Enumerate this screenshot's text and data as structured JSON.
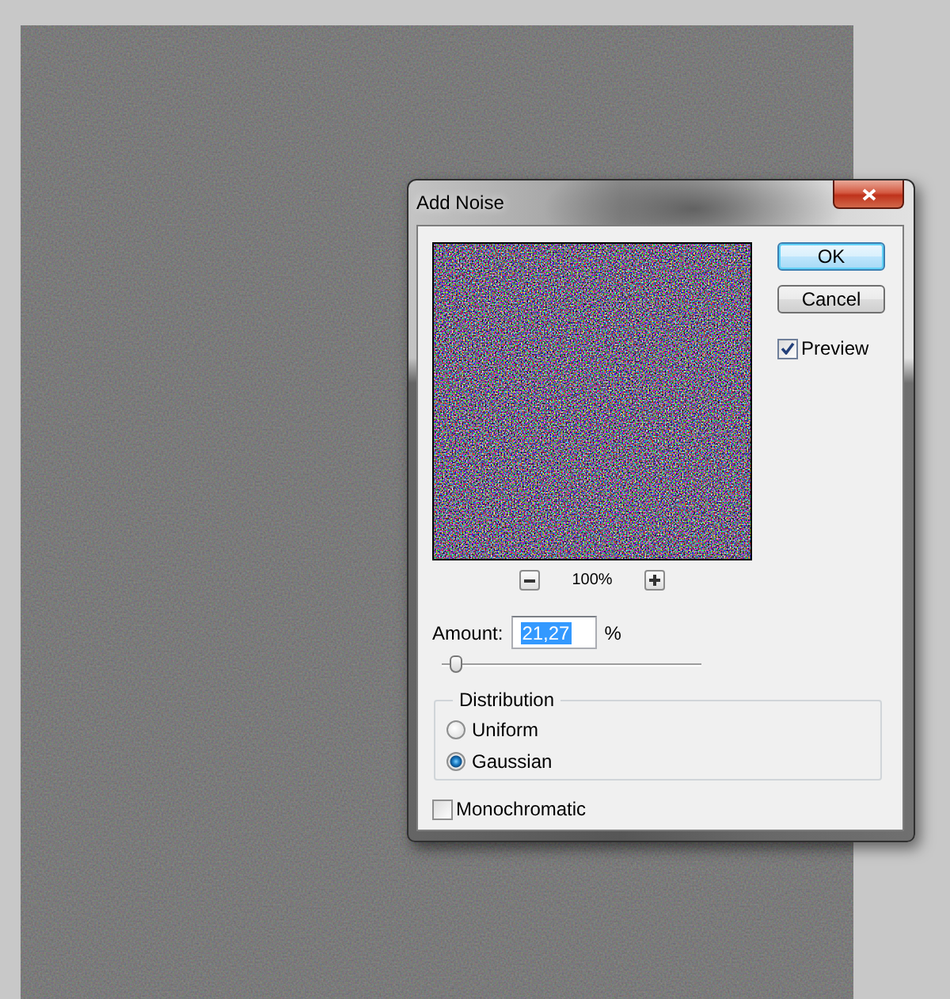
{
  "dialog": {
    "title": "Add Noise",
    "preview": {
      "zoom_level": "100%"
    },
    "buttons": [
      {
        "label": "OK",
        "default": true
      },
      {
        "label": "Cancel",
        "default": false
      }
    ],
    "preview_toggle": {
      "label": "Preview",
      "checked": true
    },
    "amount": {
      "label": "Amount:",
      "value": "21,27",
      "value_highlighted": true,
      "unit": "%",
      "level": 0.053
    },
    "distribution": {
      "title": "Distribution",
      "options": [
        {
          "label": "Uniform",
          "selected": false
        },
        {
          "label": "Gaussian",
          "selected": true
        }
      ]
    },
    "monochromatic": {
      "label": "Monochromatic",
      "checked": false
    }
  }
}
